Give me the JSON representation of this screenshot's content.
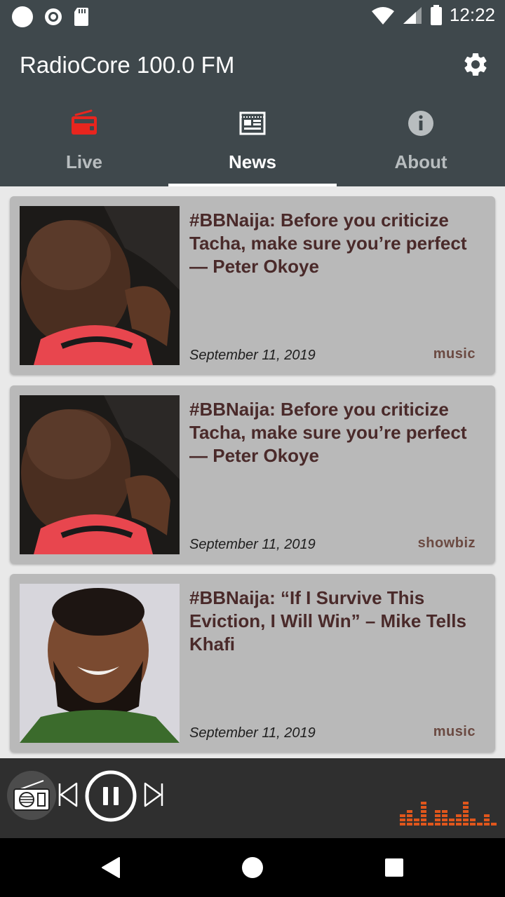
{
  "status": {
    "time": "12:22"
  },
  "app": {
    "title": "RadioCore 100.0 FM"
  },
  "tabs": [
    {
      "label": "Live",
      "icon": "radio-icon",
      "active": false
    },
    {
      "label": "News",
      "icon": "news-icon",
      "active": true
    },
    {
      "label": "About",
      "icon": "info-icon",
      "active": false
    }
  ],
  "news": [
    {
      "title": "#BBNaija: Before you criticize Tacha, make sure you’re perfect — Peter Okoye",
      "date": "September 11, 2019",
      "category": "music"
    },
    {
      "title": "#BBNaija: Before you criticize Tacha, make sure you’re perfect — Peter Okoye",
      "date": "September 11, 2019",
      "category": "showbiz"
    },
    {
      "title": "#BBNaija: “If I Survive This Eviction, I Will Win” – Mike Tells Khafi",
      "date": "September 11, 2019",
      "category": "music"
    }
  ],
  "player": {
    "state": "playing"
  },
  "colors": {
    "bar": "#3f484c",
    "accent_live": "#e8251e",
    "equalizer": "#e0561c",
    "card": "#b9b9b9",
    "title_text": "#4a2a2a"
  }
}
